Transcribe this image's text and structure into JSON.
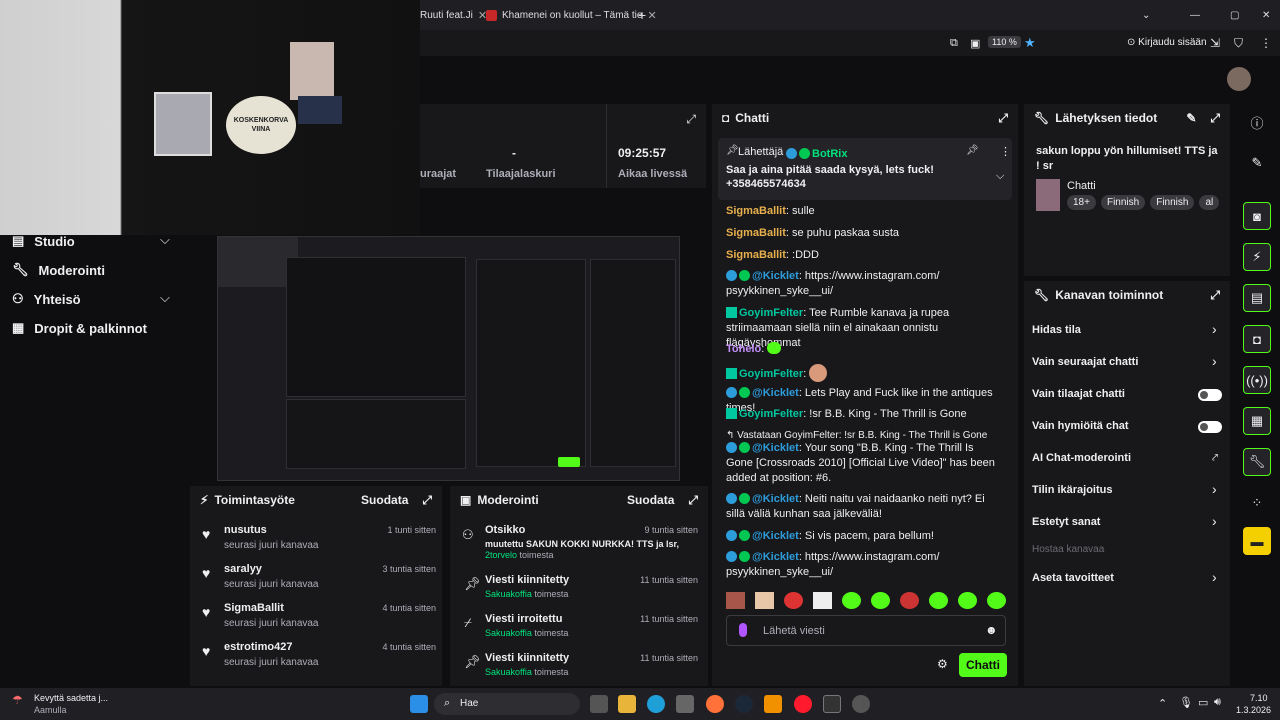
{
  "browser": {
    "tabs": [
      {
        "label": "Ruuti feat.Ji",
        "close": "✕"
      },
      {
        "label": "Khamenei on kuollut – Tämä tie",
        "close": "✕"
      }
    ],
    "new_tab": "+",
    "zoom": "110 %",
    "login": "Kirjaudu sisään"
  },
  "webcam": {
    "sign_text": "KOSKENKORVA VIINA"
  },
  "stats": [
    {
      "value": "",
      "label": "uraajat"
    },
    {
      "value": "-",
      "label": "Tilaajalaskuri"
    },
    {
      "value": "09:25:57",
      "label": "Aikaa livessä"
    }
  ],
  "nav": [
    {
      "label": "Studio",
      "icon": "studio-icon",
      "chevron": true
    },
    {
      "label": "Moderointi",
      "icon": "wrench-icon",
      "chevron": false
    },
    {
      "label": "Yhteisö",
      "icon": "community-icon",
      "chevron": true
    },
    {
      "label": "Dropit & palkinnot",
      "icon": "gift-icon",
      "chevron": false
    }
  ],
  "activity": {
    "title": "Toimintasyöte",
    "filter": "Suodata",
    "items": [
      {
        "user": "nusutus",
        "desc": "seurasi juuri kanavaa",
        "time": "1 tunti sitten"
      },
      {
        "user": "saralyy",
        "desc": "seurasi juuri kanavaa",
        "time": "3 tuntia sitten"
      },
      {
        "user": "SigmaBallit",
        "desc": "seurasi juuri kanavaa",
        "time": "4 tuntia sitten"
      },
      {
        "user": "estrotimo427",
        "desc": "seurasi juuri kanavaa",
        "time": "4 tuntia sitten"
      }
    ]
  },
  "moderation": {
    "title": "Moderointi",
    "filter": "Suodata",
    "items": [
      {
        "title": "Otsikko",
        "line1": "muutettu SAKUN KOKKI NURKKA! TTS ja lsr,",
        "by": "2torvelo",
        "action": "toimesta",
        "time": "9 tuntia sitten"
      },
      {
        "title": "Viesti kiinnitetty",
        "line1": "",
        "by": "Sakuakoffia",
        "action": "toimesta",
        "time": "11 tuntia sitten"
      },
      {
        "title": "Viesti irroitettu",
        "line1": "",
        "by": "Sakuakoffia",
        "action": "toimesta",
        "time": "11 tuntia sitten"
      },
      {
        "title": "Viesti kiinnitetty",
        "line1": "",
        "by": "Sakuakoffia",
        "action": "toimesta",
        "time": "11 tuntia sitten"
      }
    ]
  },
  "chat": {
    "title": "Chatti",
    "pinned": {
      "label": "Lähettäjä",
      "sender": "BotRix",
      "text": "Saa ja aina pitää saada kysyä, lets fuck! +358465574634"
    },
    "messages": [
      {
        "user": "SigmaBallit",
        "color": "#e8b04c",
        "text": ": sulle"
      },
      {
        "user": "SigmaBallit",
        "color": "#e8b04c",
        "text": ": se puhu paskaa susta"
      },
      {
        "user": "SigmaBallit",
        "color": "#e8b04c",
        "text": ": :DDD"
      },
      {
        "user": "@Kicklet",
        "color": "#2d9cdb",
        "text": ": https://www.instagram.com/ psyykkinen_syke__ui/"
      },
      {
        "user": "GoyimFelter",
        "color": "#00c8a0",
        "text": ": Tee Rumble kanava ja rupea striimaamaan siellä niin el ainakaan onnistu flägäyshommat"
      },
      {
        "user": "Tohelo",
        "color": "#c38ef9",
        "text": ":"
      },
      {
        "user": "GoyimFelter",
        "color": "#00c8a0",
        "text": ":"
      },
      {
        "user": "@Kicklet",
        "color": "#2d9cdb",
        "text": ": Lets Play and Fuck like in the antiques times!"
      },
      {
        "user": "GoyimFelter",
        "color": "#00c8a0",
        "text": ": !sr B.B. King - The Thrill is Gone"
      },
      {
        "reply": "Vastataan GoyimFelter: !sr B.B. King - The Thrill is Gone"
      },
      {
        "user": "@Kicklet",
        "color": "#2d9cdb",
        "text": ": Your song \"B.B. King - The Thrill Is Gone [Crossroads 2010] [Official Live Video]\" has been added at position: #6."
      },
      {
        "user": "@Kicklet",
        "color": "#2d9cdb",
        "text": ": Neiti naitu vai naidaanko neiti nyt? Ei sillä väliä kunhan saa jälkeväliä!"
      },
      {
        "user": "@Kicklet",
        "color": "#2d9cdb",
        "text": ": Si vis pacem, para bellum!"
      },
      {
        "user": "@Kicklet",
        "color": "#2d9cdb",
        "text": ": https://www.instagram.com/ psyykkinen_syke__ui/"
      }
    ],
    "input_placeholder": "Lähetä viesti",
    "send": "Chatti"
  },
  "stream_info": {
    "title": "Lähetyksen tiedot",
    "stream_title": "sakun loppu yön hillumiset! TTS ja ! sr",
    "category": "Chatti",
    "tags": [
      "18+",
      "Finnish",
      "Finnish",
      "al"
    ]
  },
  "channel_actions": {
    "title": "Kanavan toiminnot",
    "items": [
      {
        "label": "Hidas tila",
        "control": "chevron"
      },
      {
        "label": "Vain seuraajat chatti",
        "control": "chevron"
      },
      {
        "label": "Vain tilaajat chatti",
        "control": "toggle"
      },
      {
        "label": "Vain hymiöitä chat",
        "control": "toggle"
      },
      {
        "label": "AI Chat-moderointi",
        "control": "external"
      },
      {
        "label": "Tilin ikärajoitus",
        "control": "chevron"
      },
      {
        "label": "Estetyt sanat",
        "control": "chevron"
      },
      {
        "label": "Hostaa kanavaa",
        "control": "none"
      },
      {
        "label": "Aseta tavoitteet",
        "control": "chevron"
      }
    ]
  },
  "taskbar": {
    "notification": "Kevyttä sadetta j...",
    "notification_sub": "Aamulla",
    "search": "Hae",
    "time": "7.10",
    "date": "1.3.2026"
  }
}
